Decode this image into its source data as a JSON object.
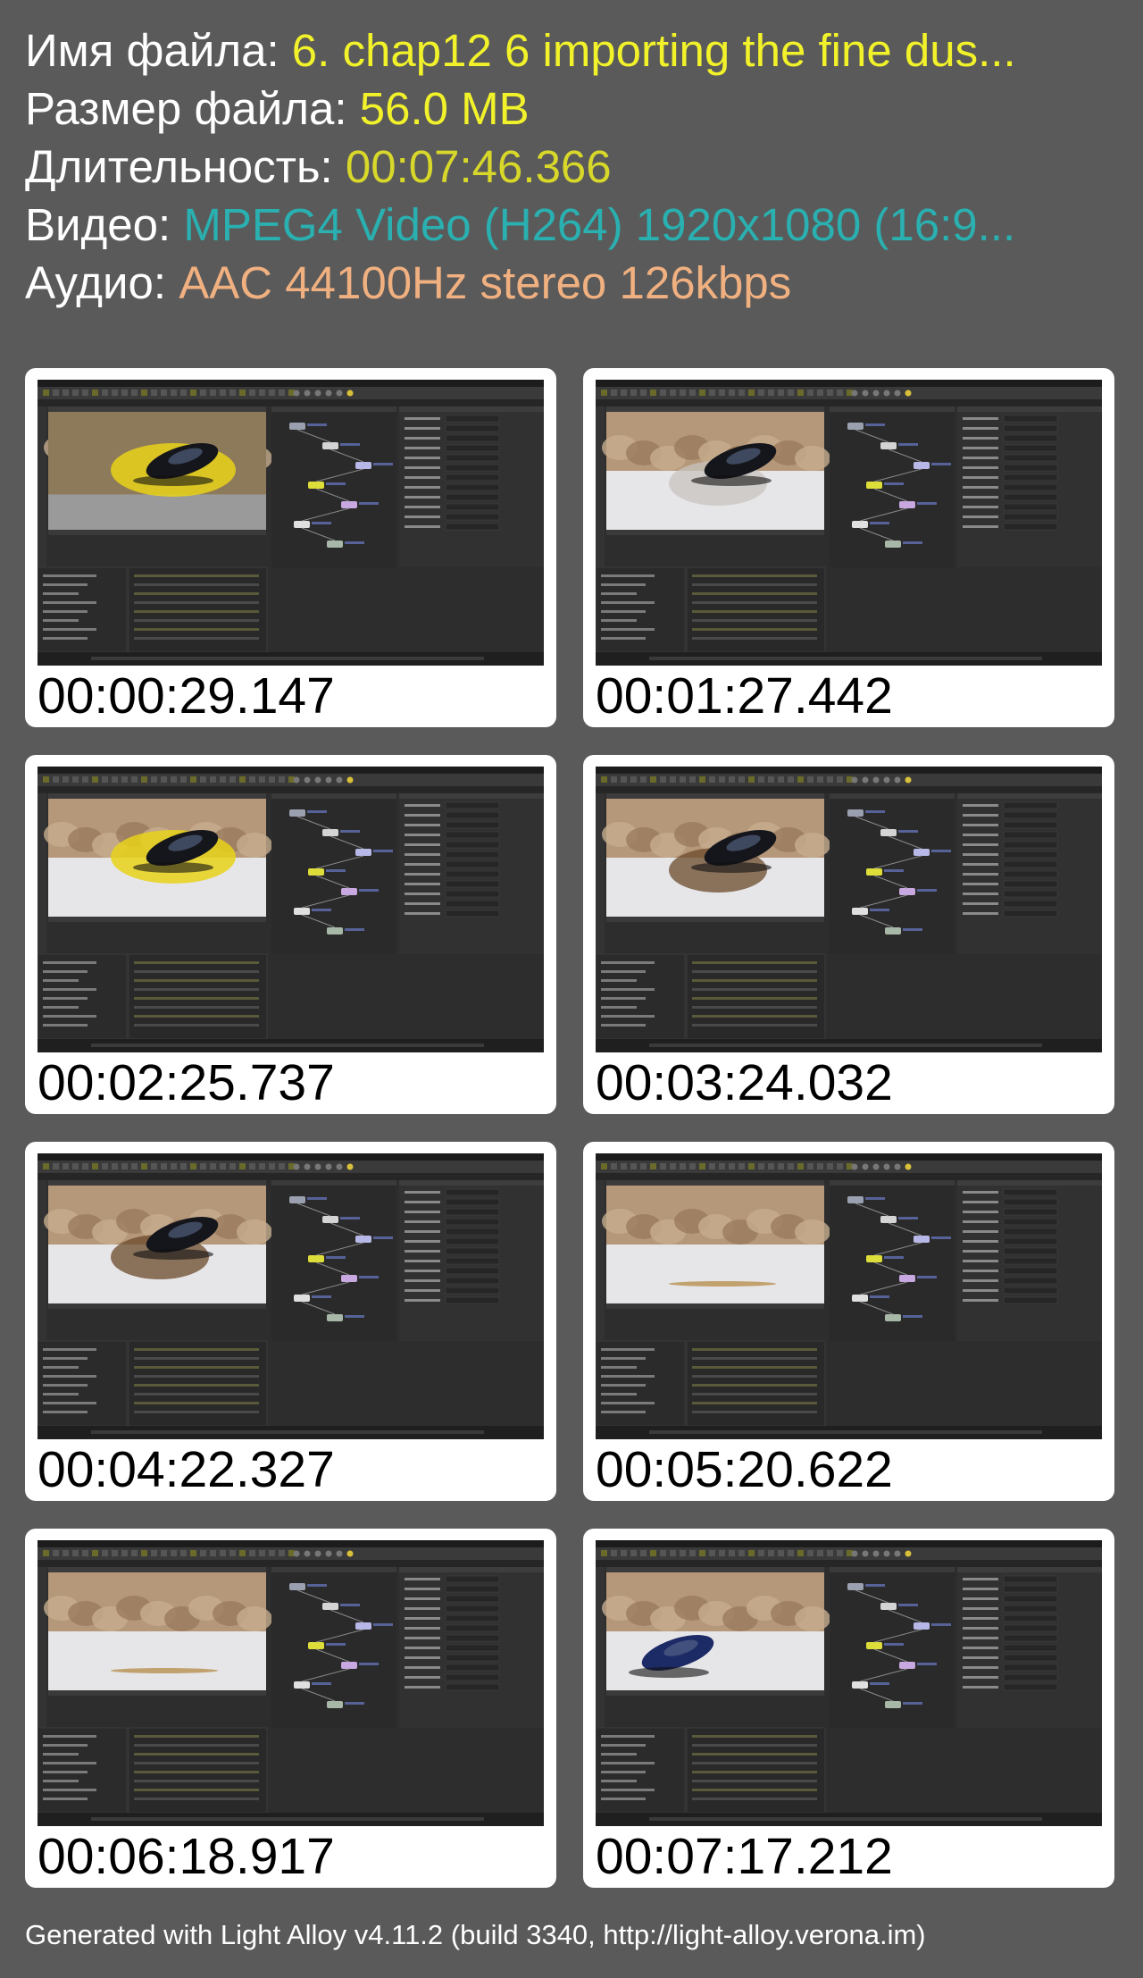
{
  "info": {
    "filename_label": "Имя файла: ",
    "filename_value": "6. chap12 6 importing the fine dus...",
    "filesize_label": "Размер файла: ",
    "filesize_value": "56.0 MB",
    "duration_label": "Длительность: ",
    "duration_value": "00:07:46.366",
    "video_label": "Видео: ",
    "video_value": "MPEG4 Video (H264) 1920x1080 (16:9...",
    "audio_label": "Аудио: ",
    "audio_value": "AAC 44100Hz stereo 126kbps"
  },
  "colors": {
    "label": "#ffffff",
    "filename": "#f2f22a",
    "filesize": "#f2f22a",
    "duration": "#d8d82a",
    "video": "#2ab0b0",
    "audio": "#f0b080",
    "background": "#5a5a5a"
  },
  "thumbnails": [
    {
      "timestamp": "00:00:29.147",
      "scene": "yellow-dust-car-on-brick"
    },
    {
      "timestamp": "00:01:27.442",
      "scene": "car-white-snow-dust"
    },
    {
      "timestamp": "00:02:25.737",
      "scene": "yellow-dust-car-snow"
    },
    {
      "timestamp": "00:03:24.032",
      "scene": "car-brown-dust-snow"
    },
    {
      "timestamp": "00:04:22.327",
      "scene": "car-brown-dust-snow"
    },
    {
      "timestamp": "00:05:20.622",
      "scene": "empty-snow"
    },
    {
      "timestamp": "00:06:18.917",
      "scene": "empty-snow"
    },
    {
      "timestamp": "00:07:17.212",
      "scene": "blue-car-snow"
    }
  ],
  "footer": {
    "text": "Generated with Light Alloy v4.11.2 (build 3340, http://light-alloy.verona.im)"
  }
}
